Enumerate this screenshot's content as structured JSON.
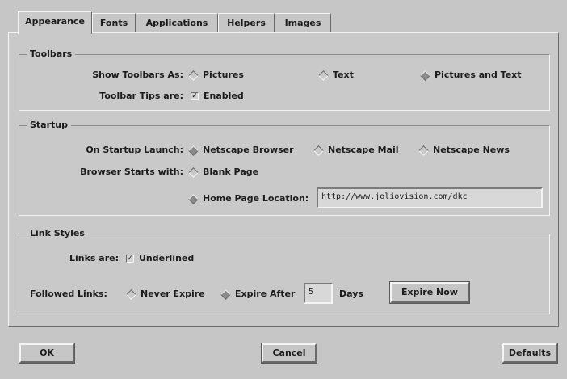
{
  "tabs": [
    "Appearance",
    "Fonts",
    "Applications",
    "Helpers",
    "Images"
  ],
  "toolbars": {
    "legend": "Toolbars",
    "show_as_label": "Show Toolbars As:",
    "options": [
      "Pictures",
      "Text",
      "Pictures and Text"
    ],
    "selected": "Pictures and Text",
    "tips_label": "Toolbar Tips are:",
    "tips_checkbox": "Enabled",
    "tips_checked": true
  },
  "startup": {
    "legend": "Startup",
    "launch_label": "On Startup Launch:",
    "launch_options": [
      "Netscape Browser",
      "Netscape Mail",
      "Netscape News"
    ],
    "browser_starts_label": "Browser Starts with:",
    "blank_page": "Blank Page",
    "home_page_label": "Home Page Location:",
    "home_page_value": "http://www.joliovision.com/dkc",
    "selected_start": "Home Page Location:"
  },
  "link_styles": {
    "legend": "Link Styles",
    "links_are_label": "Links are:",
    "underlined": "Underlined",
    "underlined_checked": true,
    "followed_label": "Followed Links:",
    "never_expire": "Never Expire",
    "expire_after": "Expire After",
    "days_value": "5",
    "days_label": "Days",
    "expire_now": "Expire Now",
    "selected_expiry": "Expire After"
  },
  "buttons": {
    "ok": "OK",
    "cancel": "Cancel",
    "defaults": "Defaults"
  },
  "colors": {
    "background": "#c6c6c6",
    "highlight": "#f4f4f4",
    "shadow": "#6a6a6a"
  }
}
